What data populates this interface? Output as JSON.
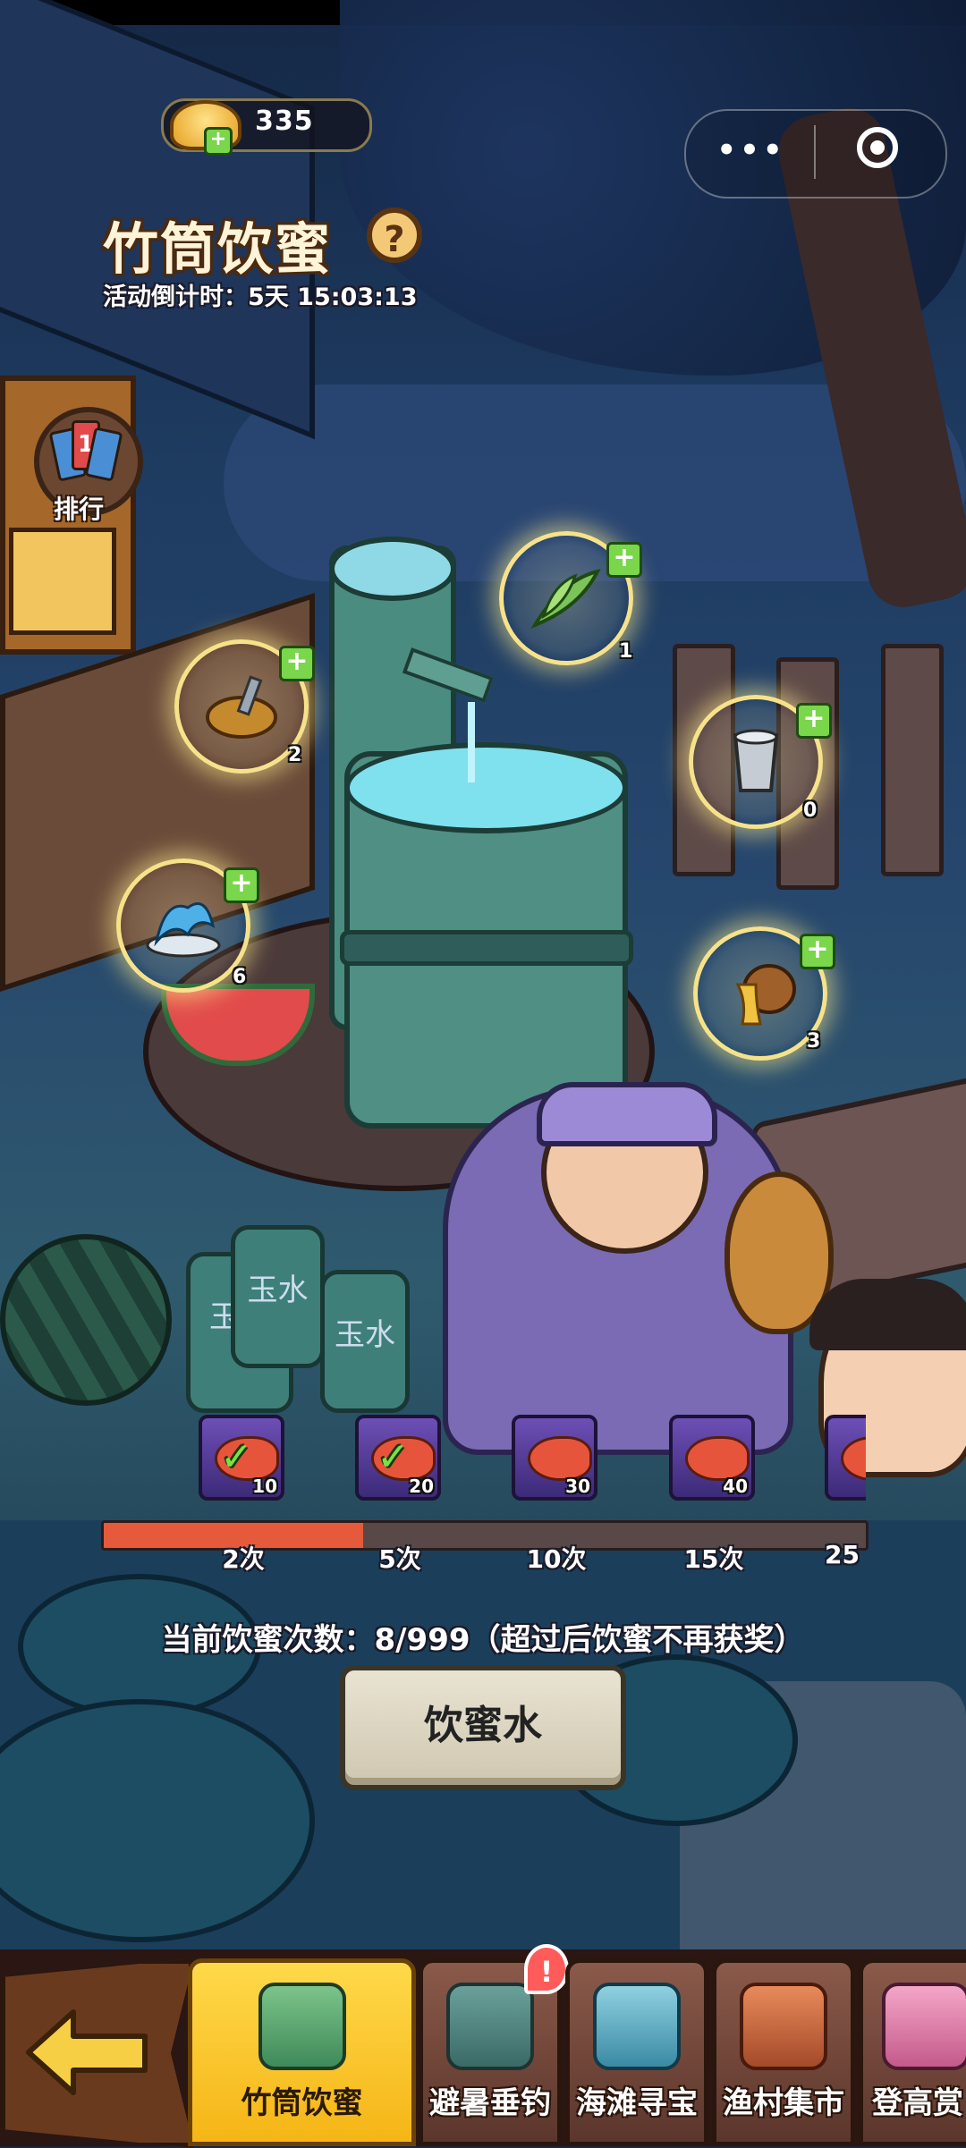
{
  "currency": {
    "value": "335",
    "icon": "gold-ingot-icon"
  },
  "event": {
    "title": "竹筒饮蜜",
    "help_glyph": "?",
    "countdown": "活动倒计时：5天 15:03:13"
  },
  "ranking": {
    "label": "排行",
    "badge_digit": "1"
  },
  "items": [
    {
      "name": "bamboo-leaf",
      "count": "1"
    },
    {
      "name": "honey-mash",
      "count": "2"
    },
    {
      "name": "silver-cup",
      "count": "0"
    },
    {
      "name": "water-splash",
      "count": "6"
    },
    {
      "name": "honey-jar",
      "count": "3"
    }
  ],
  "jars": [
    "玉水",
    "玉水",
    "玉水"
  ],
  "rewards": [
    {
      "qty": "10",
      "claimed": true
    },
    {
      "qty": "20",
      "claimed": true
    },
    {
      "qty": "30",
      "claimed": false
    },
    {
      "qty": "40",
      "claimed": false
    },
    {
      "qty": "",
      "claimed": false
    }
  ],
  "milestones": [
    "2次",
    "5次",
    "10次",
    "15次",
    "25"
  ],
  "progress": {
    "fraction": 0.34
  },
  "status_text": "当前饮蜜次数：8/999（超过后饮蜜不再获奖）",
  "main_button": "饮蜜水",
  "nav": {
    "tabs": [
      {
        "label": "竹筒饮蜜",
        "active": true
      },
      {
        "label": "避暑垂钓",
        "active": false,
        "badge": "!"
      },
      {
        "label": "海滩寻宝",
        "active": false
      },
      {
        "label": "渔村集市",
        "active": false
      },
      {
        "label": "登高赏",
        "active": false
      }
    ]
  },
  "colors": {
    "accent_gold": "#f5b516",
    "progress_red": "#e45a3b",
    "plus_green": "#7ad64a"
  }
}
